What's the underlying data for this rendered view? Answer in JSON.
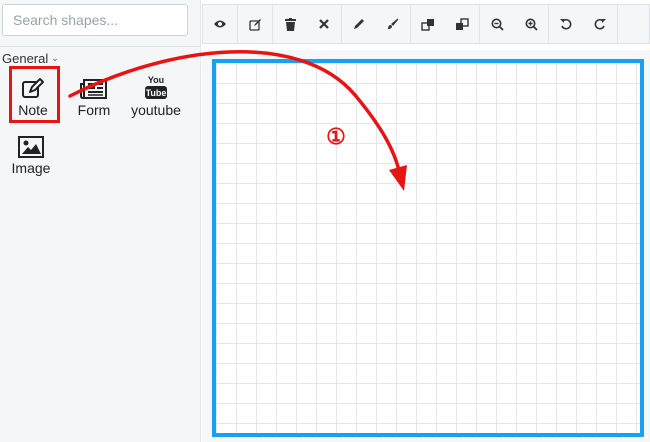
{
  "search": {
    "placeholder": "Search shapes..."
  },
  "category": {
    "label": "General"
  },
  "shapes": [
    {
      "label": "Note",
      "icon": "edit-icon"
    },
    {
      "label": "Form",
      "icon": "newspaper-icon"
    },
    {
      "label": "youtube",
      "icon": "youtube-icon",
      "logo_text": "You Tube"
    },
    {
      "label": "Image",
      "icon": "image-icon"
    }
  ],
  "toolbar": {
    "buttons": [
      "eye-icon",
      "edit-icon",
      "trash-icon",
      "close-icon",
      "pencil-icon",
      "paint-brush-icon",
      "bring-front-icon",
      "send-back-icon",
      "zoom-out-icon",
      "zoom-in-icon",
      "undo-icon",
      "redo-icon"
    ]
  },
  "annotation": {
    "step": "①",
    "highlight_color": "#e81414",
    "canvas_border_color": "#1aa0f0"
  }
}
